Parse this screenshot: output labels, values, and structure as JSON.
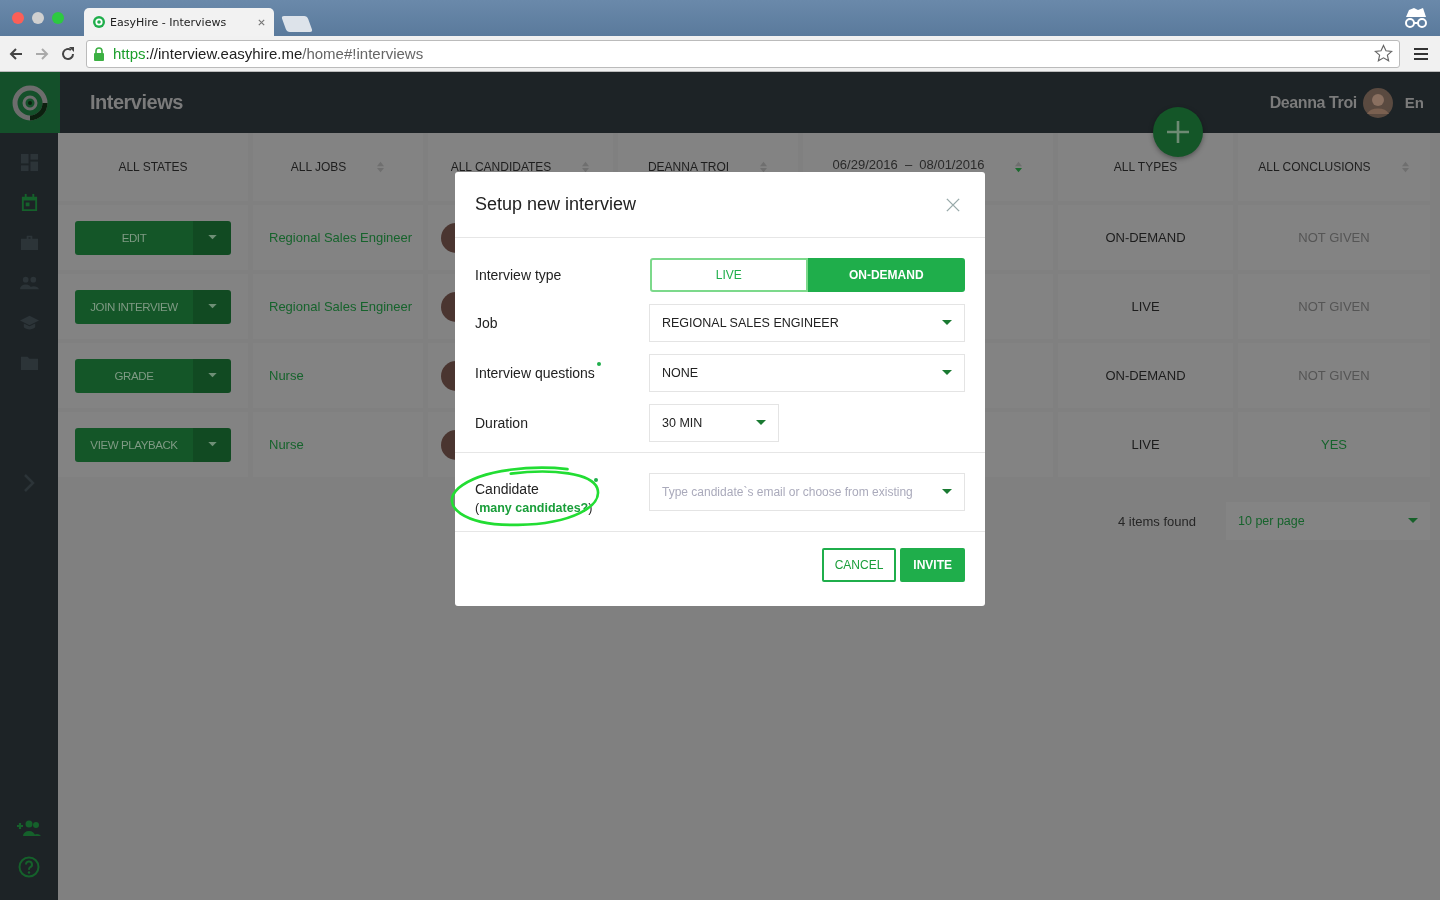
{
  "browser": {
    "tab_title": "EasyHire - Interviews",
    "url": [
      "https",
      "://interview.easyhire.me",
      "/home#!interviews"
    ]
  },
  "header": {
    "title": "Interviews",
    "user_name": "Deanna Troi",
    "language": "En"
  },
  "sidebar": {
    "items": [
      {
        "selected": false
      },
      {
        "selected": true
      },
      {
        "selected": false
      },
      {
        "selected": false
      },
      {
        "selected": false
      },
      {
        "selected": false
      }
    ]
  },
  "filters": [
    {
      "kind": "select",
      "label": "ALL STATES",
      "sortable": false
    },
    {
      "kind": "select",
      "label": "ALL JOBS",
      "sortable": true,
      "sorted": false
    },
    {
      "kind": "select",
      "label": "ALL CANDIDATES",
      "sortable": true,
      "sorted": false
    },
    {
      "kind": "select",
      "label": "DEANNA TROI",
      "sortable": true,
      "sorted": false
    },
    {
      "kind": "date-range",
      "from": "06/29/2016",
      "separator": "–",
      "to": "08/01/2016",
      "sortable": true,
      "sorted": true
    },
    {
      "kind": "select",
      "label": "ALL TYPES",
      "sortable": false
    },
    {
      "kind": "select",
      "label": "ALL CONCLUSIONS",
      "sortable": true,
      "sorted": false
    }
  ],
  "rows": [
    {
      "action": "EDIT",
      "job": "Regional Sales Engineer",
      "type": "ON-DEMAND",
      "conclusion": "NOT GIVEN",
      "positive": false
    },
    {
      "action": "JOIN INTERVIEW",
      "job": "Regional Sales Engineer",
      "type": "LIVE",
      "conclusion": "NOT GIVEN",
      "positive": false
    },
    {
      "action": "GRADE",
      "job": "Nurse",
      "type": "ON-DEMAND",
      "conclusion": "NOT GIVEN",
      "positive": false
    },
    {
      "action": "VIEW PLAYBACK",
      "job": "Nurse",
      "type": "LIVE",
      "conclusion": "YES",
      "positive": true
    }
  ],
  "pagination": {
    "count": "4 items found",
    "per_page": "10 per page"
  },
  "modal": {
    "title": "Setup new interview",
    "interview_type": {
      "label": "Interview type",
      "options": [
        {
          "label": "LIVE",
          "selected": false
        },
        {
          "label": "ON-DEMAND",
          "selected": true
        }
      ]
    },
    "job": {
      "label": "Job",
      "value": "REGIONAL SALES ENGINEER",
      "required": false
    },
    "questions": {
      "label": "Interview questions",
      "value": "NONE",
      "required": true
    },
    "duration": {
      "label": "Duration",
      "value": "30 MIN",
      "required": false
    },
    "candidate": {
      "label": "Candidate",
      "required": true,
      "link_prefix": "(",
      "link": "many candidates?",
      "link_suffix": ")",
      "placeholder": "Type candidate`s email or choose from existing"
    },
    "buttons": [
      {
        "kind": "outline",
        "label": "CANCEL"
      },
      {
        "kind": "primary",
        "label": "INVITE"
      }
    ]
  }
}
